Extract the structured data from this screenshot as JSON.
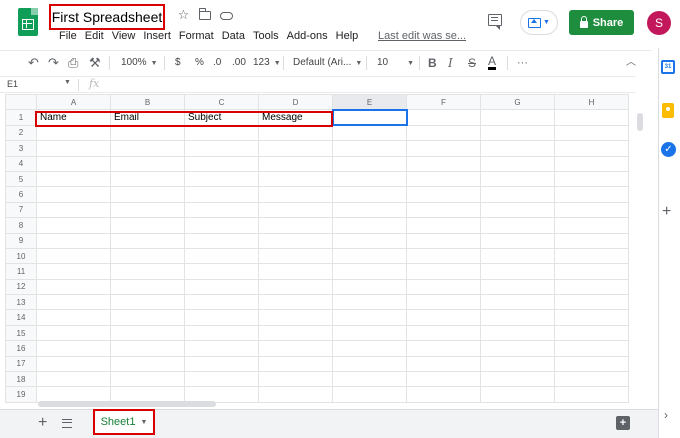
{
  "header": {
    "title": "First Spreadsheet",
    "star_icon": "star-icon",
    "move_icon": "folder-move-icon",
    "status_icon": "cloud-status-icon",
    "last_edit": "Last edit was se...",
    "share_label": "Share",
    "avatar_initial": "S",
    "share_color": "#1e8e3e",
    "avatar_color": "#c2185b"
  },
  "menu": [
    {
      "label": "File"
    },
    {
      "label": "Edit"
    },
    {
      "label": "View"
    },
    {
      "label": "Insert"
    },
    {
      "label": "Format"
    },
    {
      "label": "Data"
    },
    {
      "label": "Tools"
    },
    {
      "label": "Add-ons"
    },
    {
      "label": "Help"
    }
  ],
  "toolbar": {
    "zoom": "100%",
    "currency": "$",
    "percent": "%",
    "decrease_decimal": ".0",
    "increase_decimal": ".00",
    "number_format": "123",
    "font": "Default (Ari...",
    "font_size": "10",
    "bold": "B",
    "italic": "I",
    "strike": "S",
    "text_color": "A",
    "more": "···"
  },
  "formula_bar": {
    "cell_ref": "E1",
    "fx": "fx",
    "value": ""
  },
  "sheet": {
    "columns": [
      "A",
      "B",
      "C",
      "D",
      "E",
      "F",
      "G",
      "H"
    ],
    "selected_column": "E",
    "selected_cell": "E1",
    "header_row": [
      "Name",
      "Email",
      "Subject",
      "Message",
      "",
      "",
      "",
      ""
    ],
    "row_count": 19
  },
  "bottom": {
    "sheet_tab": "Sheet1",
    "tab_color": "#188038"
  },
  "side_panel": {
    "calendar_label": "31",
    "tasks_label": "✓",
    "add_label": "+"
  }
}
